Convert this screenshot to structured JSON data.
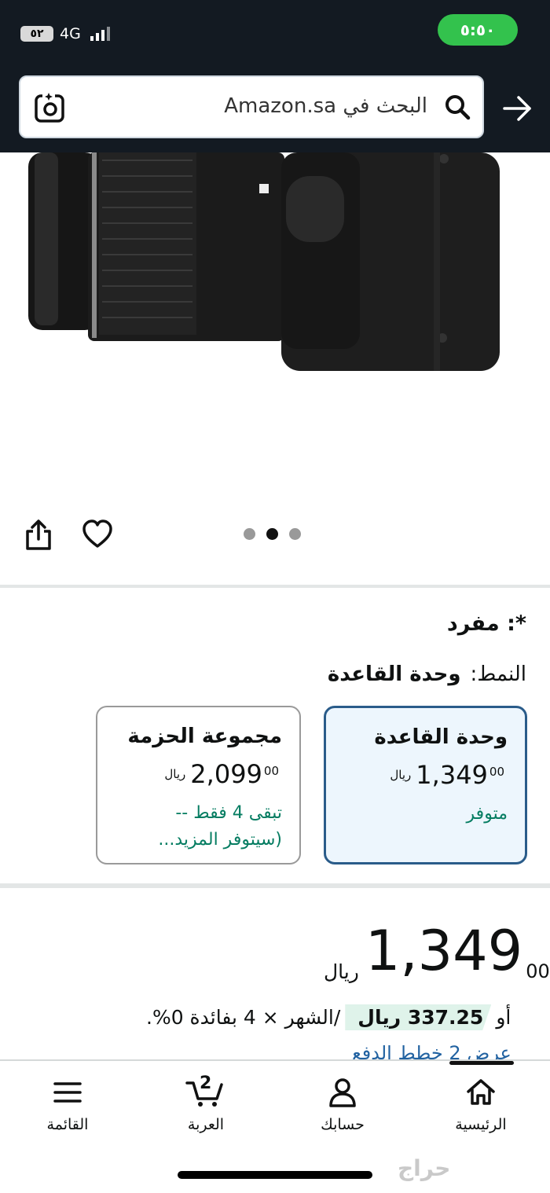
{
  "status_bar": {
    "battery": "٥٢",
    "network": "4G",
    "time": "٥:٥٠"
  },
  "search": {
    "placeholder": "البحث في Amazon.sa",
    "icon": "search-icon",
    "camera_icon": "camera-plus-icon",
    "back_icon": "arrow-right-icon"
  },
  "carousel": {
    "dots": 3,
    "active_dot": 2,
    "share_icon": "share-icon",
    "wishlist_icon": "heart-icon"
  },
  "variants": {
    "selection_line": "*: مفرد",
    "style_label": "النمط:",
    "style_value": "وحدة القاعدة",
    "options": [
      {
        "title": "وحدة القاعدة",
        "price_whole": "1,349",
        "price_fraction": "00",
        "currency": "ريال",
        "status_line1": "متوفر",
        "status_line2": "",
        "selected": true
      },
      {
        "title": "مجموعة الحزمة",
        "price_whole": "2,099",
        "price_fraction": "00",
        "currency": "ريال",
        "status_line1": "تبقى 4 فقط --",
        "status_line2": "(سيتوفر المزيد...",
        "selected": false
      }
    ]
  },
  "price": {
    "currency": "ريال",
    "whole": "1,349",
    "fraction": "00"
  },
  "installment": {
    "prefix": "أو",
    "amount": "337.25 ريال",
    "suffix": "/الشهر × 4 بفائدة 0%.",
    "link": "عرض 2 خطط الدفع"
  },
  "bottom_nav": [
    {
      "label": "الرئيسية",
      "icon": "home-icon"
    },
    {
      "label": "حسابك",
      "icon": "account-icon"
    },
    {
      "label": "العربة",
      "icon": "cart-icon",
      "badge": "2"
    },
    {
      "label": "القائمة",
      "icon": "menu-icon"
    }
  ],
  "watermark": "حراج",
  "colors": {
    "header": "#131a22",
    "clock_pill": "#33c24d",
    "selected_border": "#2a5c8a",
    "selected_bg": "#edf6fd",
    "in_stock": "#067d62",
    "link": "#2162a1"
  }
}
